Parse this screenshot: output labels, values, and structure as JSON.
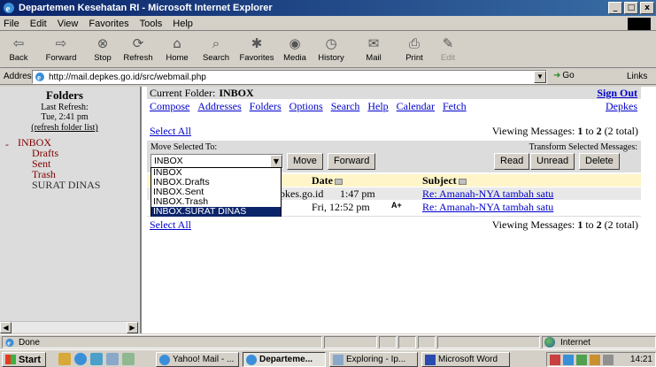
{
  "window": {
    "title": "Departemen Kesehatan RI - Microsoft Internet Explorer",
    "controls": [
      "_",
      "□",
      "x"
    ]
  },
  "menu": [
    "File",
    "Edit",
    "View",
    "Favorites",
    "Tools",
    "Help"
  ],
  "toolbar": {
    "back": "Back",
    "forward": "Forward",
    "stop": "Stop",
    "refresh": "Refresh",
    "home": "Home",
    "search": "Search",
    "favorites": "Favorites",
    "media": "Media",
    "history": "History",
    "mail": "Mail",
    "print": "Print",
    "edit": "Edit"
  },
  "address": {
    "label": "Address",
    "url": "http://mail.depkes.go.id/src/webmail.php",
    "go": "Go",
    "links": "Links"
  },
  "left": {
    "title": "Folders",
    "last_refresh_label": "Last Refresh:",
    "last_refresh_time": "Tue, 2:41 pm",
    "refresh_link": "(refresh folder list)",
    "dash": "-",
    "folders": [
      "INBOX",
      "Drafts",
      "Sent",
      "Trash",
      "SURAT DINAS"
    ]
  },
  "main": {
    "current_folder_label": "Current Folder:",
    "current_folder": "INBOX",
    "sign_out": "Sign Out",
    "nav": [
      "Compose",
      "Addresses",
      "Folders",
      "Options",
      "Search",
      "Help",
      "Calendar",
      "Fetch"
    ],
    "nav_right": "Depkes",
    "select_all": "Select All",
    "viewing_prefix": "Viewing Messages:",
    "viewing_from": "1",
    "viewing_to_word": "to",
    "viewing_to": "2",
    "viewing_total": "(2 total)",
    "move_label": "Move Selected To:",
    "transform_label": "Transform Selected Messages:",
    "move_select_value": "INBOX",
    "move_button": "Move",
    "forward_button": "Forward",
    "read_button": "Read",
    "unread_button": "Unread",
    "delete_button": "Delete",
    "col_date": "Date",
    "col_subject": "Subject",
    "messages": [
      {
        "from": "pkes.go.id",
        "date": "1:47 pm",
        "subject": "Re: Amanah-NYA tambah satu"
      },
      {
        "from": "",
        "date": "Fri, 12:52 pm",
        "flag": "A+",
        "subject": "Re: Amanah-NYA tambah satu"
      }
    ],
    "dropdown_options": [
      "INBOX",
      "INBOX.Drafts",
      "INBOX.Sent",
      "INBOX.Trash",
      "INBOX.SURAT DINAS"
    ],
    "dropdown_selected_index": 4
  },
  "status": {
    "text": "Done",
    "zone": "Internet"
  },
  "taskbar": {
    "start": "Start",
    "tasks": [
      "Yahoo! Mail - ...",
      "Departeme...",
      "Exploring - Ip...",
      "Microsoft Word"
    ],
    "clock": "14:21"
  }
}
